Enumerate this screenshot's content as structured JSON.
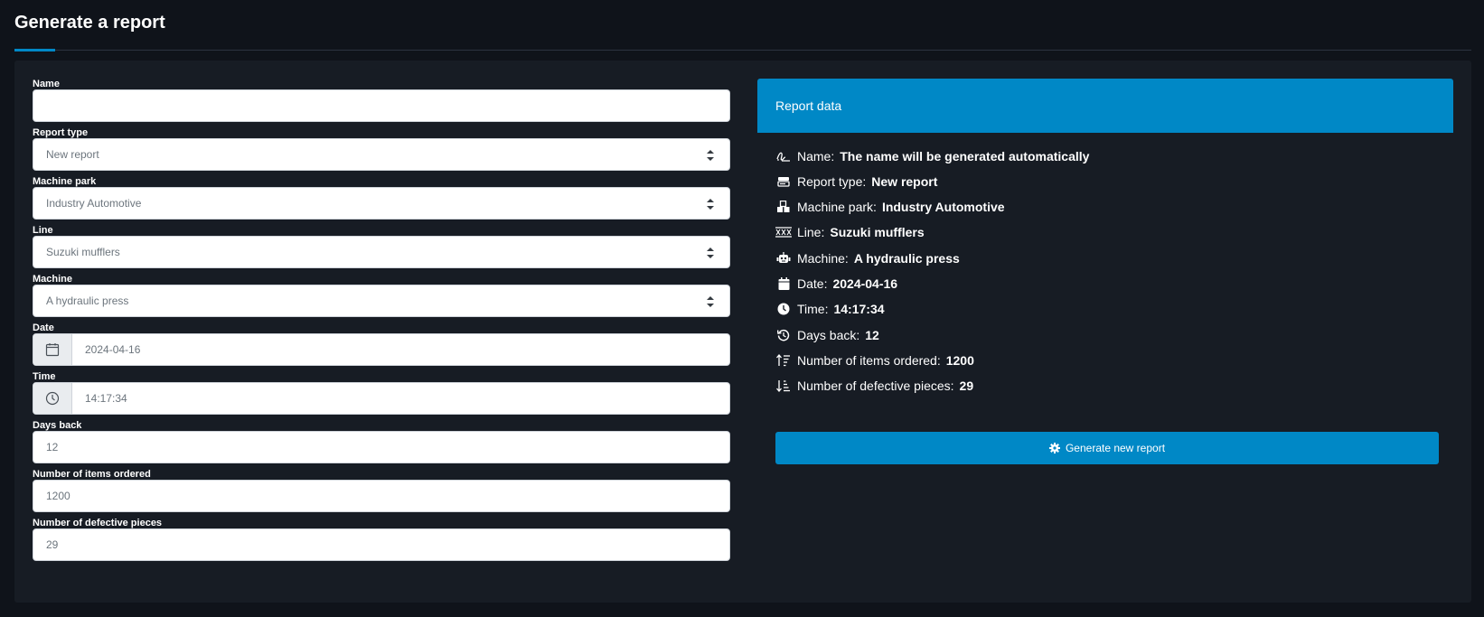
{
  "page": {
    "title": "Generate a report"
  },
  "colors": {
    "accent": "#0088c6",
    "background": "#0f131a",
    "card": "#171c24"
  },
  "form": {
    "name": {
      "label": "Name",
      "value": ""
    },
    "report_type": {
      "label": "Report type",
      "value": "New report"
    },
    "machine_park": {
      "label": "Machine park",
      "value": "Industry Automotive"
    },
    "line": {
      "label": "Line",
      "value": "Suzuki mufflers"
    },
    "machine": {
      "label": "Machine",
      "value": "A hydraulic press"
    },
    "date": {
      "label": "Date",
      "value": "2024-04-16",
      "icon": "calendar-icon"
    },
    "time": {
      "label": "Time",
      "value": "14:17:34",
      "icon": "clock-icon"
    },
    "days_back": {
      "label": "Days back",
      "value": "12"
    },
    "items_ordered": {
      "label": "Number of items ordered",
      "value": "1200"
    },
    "defective": {
      "label": "Number of defective pieces",
      "value": "29"
    }
  },
  "report": {
    "title": "Report data",
    "rows": [
      {
        "icon": "signature-icon",
        "label": "Name:",
        "value": "The name will be generated automatically"
      },
      {
        "icon": "report-type-icon",
        "label": "Report type:",
        "value": "New report"
      },
      {
        "icon": "cubes-icon",
        "label": "Machine park:",
        "value": "Industry Automotive"
      },
      {
        "icon": "line-icon",
        "label": "Line:",
        "value": "Suzuki mufflers"
      },
      {
        "icon": "robot-icon",
        "label": "Machine:",
        "value": "A hydraulic press"
      },
      {
        "icon": "calendar-icon",
        "label": "Date:",
        "value": "2024-04-16"
      },
      {
        "icon": "clock-icon",
        "label": "Time:",
        "value": "14:17:34"
      },
      {
        "icon": "history-icon",
        "label": "Days back:",
        "value": "12"
      },
      {
        "icon": "sort-up-icon",
        "label": "Number of items ordered:",
        "value": "1200"
      },
      {
        "icon": "sort-down-icon",
        "label": "Number of defective pieces:",
        "value": "29"
      }
    ],
    "button_label": "Generate new report",
    "button_icon": "gear-icon"
  }
}
